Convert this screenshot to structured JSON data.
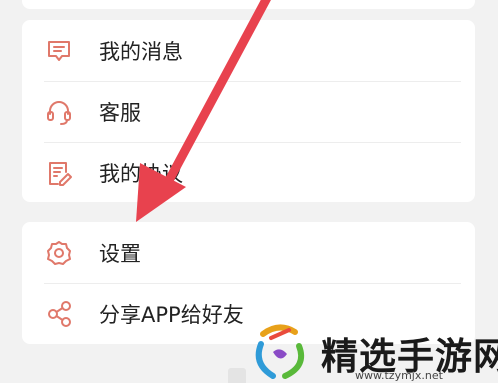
{
  "menu_group_1": {
    "items": [
      {
        "label": "我的消息",
        "icon": "message-icon"
      },
      {
        "label": "客服",
        "icon": "headset-icon"
      },
      {
        "label": "我的协议",
        "icon": "agreement-icon"
      }
    ]
  },
  "menu_group_2": {
    "items": [
      {
        "label": "设置",
        "icon": "gear-icon"
      },
      {
        "label": "分享APP给好友",
        "icon": "share-icon"
      }
    ]
  },
  "watermark": {
    "brand": "精选手游网",
    "url": "www.tzymjx.net"
  },
  "colors": {
    "icon": "#e0786a",
    "arrow": "#e8424e",
    "background": "#f2f2f2",
    "card": "#ffffff"
  }
}
